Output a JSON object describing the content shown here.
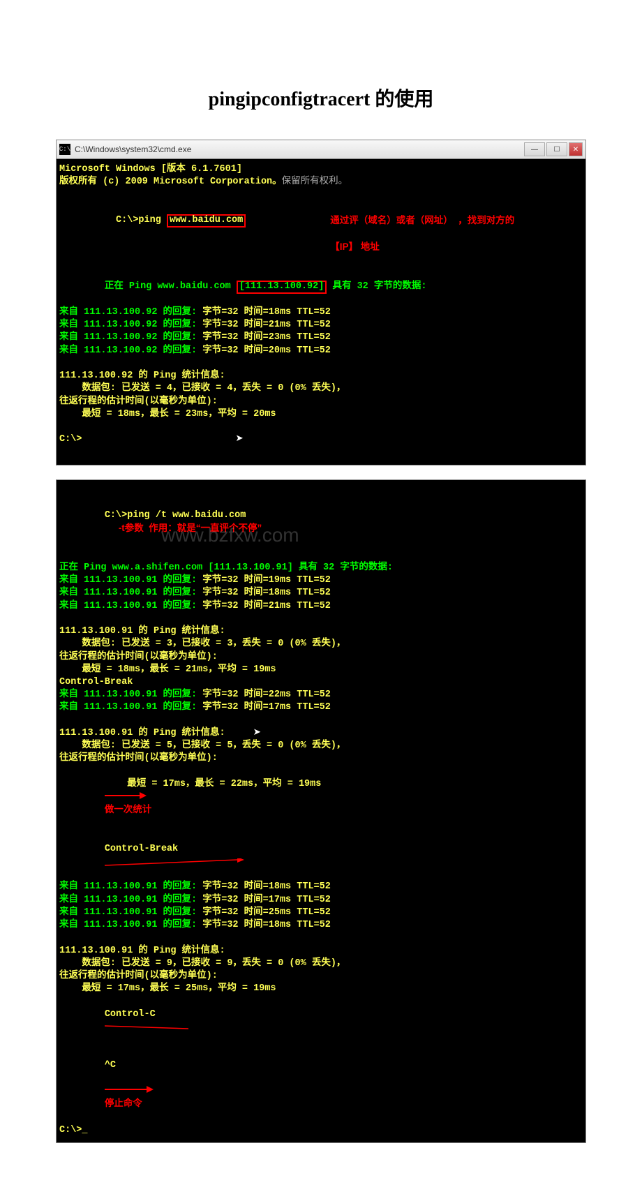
{
  "doc_title": "pingipconfigtracert 的使用",
  "window1": {
    "titlebar_path": "C:\\Windows\\system32\\cmd.exe",
    "icon_text": "C:\\",
    "header1": "Microsoft Windows [版本 6.1.7601]",
    "header2_a": "版权所有 (c) 2009 Microsoft Corporation。",
    "header2_b": "保留所有权利。",
    "prompt1_a": "C:\\>ping ",
    "prompt1_box": "www.baidu.com",
    "anno1_a": "通过评（域名）或者（网址）  ，找到对方的",
    "anno1_b": "【IP】 地址",
    "ping_hdr_a": "正在 Ping www.baidu.com ",
    "ping_hdr_box": "[111.13.100.92]",
    "ping_hdr_b": " 具有 32 字节的数据:",
    "reply_prefix": "来自 111.13.100.92 的回复: ",
    "reply1": "字节=32 时间=18ms TTL=52",
    "reply2": "字节=32 时间=21ms TTL=52",
    "reply3": "字节=32 时间=23ms TTL=52",
    "reply4": "字节=32 时间=20ms TTL=52",
    "stats_hdr": "111.13.100.92 的 Ping 统计信息:",
    "stats_pk": "    数据包: 已发送 = 4，已接收 = 4，丢失 = 0 (0% 丢失)，",
    "stats_rtt_hdr": "往返行程的估计时间(以毫秒为单位):",
    "stats_rtt": "    最短 = 18ms，最长 = 23ms，平均 = 20ms",
    "prompt2": "C:\\>"
  },
  "window2": {
    "prompt_a": "C:\\>ping /t www.baidu.com",
    "anno_t": "-t参数  作用：就是“一直评个不停”",
    "hdr": "正在 Ping www.a.shifen.com [111.13.100.91] 具有 32 字节的数据:",
    "reply_prefix": "来自 111.13.100.91 的回复: ",
    "r1": "字节=32 时间=19ms TTL=52",
    "r2": "字节=32 时间=18ms TTL=52",
    "r3": "字节=32 时间=21ms TTL=52",
    "stats1_hdr": "111.13.100.91 的 Ping 统计信息:",
    "stats1_pk": "    数据包: 已发送 = 3，已接收 = 3，丢失 = 0 (0% 丢失)，",
    "stats1_rtt_hdr": "往返行程的估计时间(以毫秒为单位):",
    "stats1_rtt": "    最短 = 18ms，最长 = 21ms，平均 = 19ms",
    "cb1": "Control-Break",
    "r4": "字节=32 时间=22ms TTL=52",
    "r5": "字节=32 时间=17ms TTL=52",
    "stats2_hdr": "111.13.100.91 的 Ping 统计信息:",
    "stats2_pk": "    数据包: 已发送 = 5，已接收 = 5，丢失 = 0 (0% 丢失)，",
    "stats2_rtt_hdr": "往返行程的估计时间(以毫秒为单位):",
    "stats2_rtt": "    最短 = 17ms，最长 = 22ms，平均 = 19ms ",
    "anno_stat": "做一次统计",
    "cb2": "Control-Break",
    "r6": "字节=32 时间=18ms TTL=52",
    "r7": "字节=32 时间=17ms TTL=52",
    "r8": "字节=32 时间=25ms TTL=52",
    "r9": "字节=32 时间=18ms TTL=52",
    "stats3_hdr": "111.13.100.91 的 Ping 统计信息:",
    "stats3_pk": "    数据包: 已发送 = 9，已接收 = 9，丢失 = 0 (0% 丢失)，",
    "stats3_rtt_hdr": "往返行程的估计时间(以毫秒为单位):",
    "stats3_rtt": "    最短 = 17ms，最长 = 25ms，平均 = 19ms",
    "cc": "Control-C",
    "caret_c": "^C",
    "anno_stop": "停止命令",
    "prompt_end": "C:\\>_",
    "watermark": "www.bzfxw.com"
  }
}
